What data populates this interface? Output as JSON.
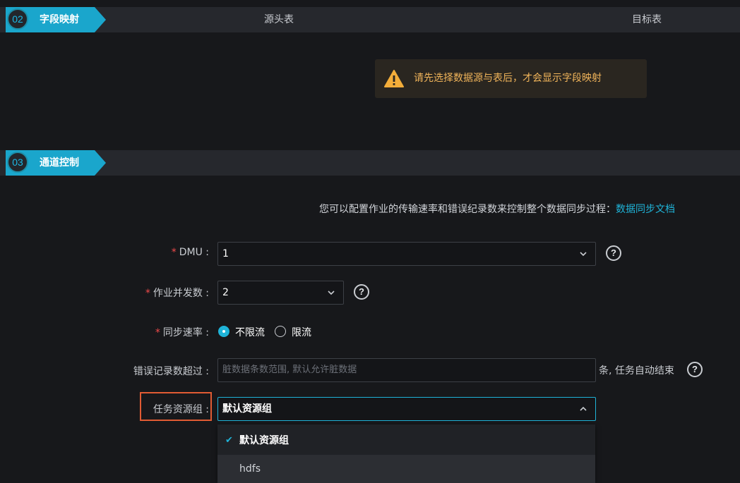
{
  "section_mapping": {
    "number": "02",
    "title": "字段映射",
    "source_table_header": "源头表",
    "target_table_header": "目标表",
    "warning_text": "请先选择数据源与表后，才会显示字段映射"
  },
  "section_channel": {
    "number": "03",
    "title": "通道控制",
    "intro_text": "您可以配置作业的传输速率和错误纪录数来控制整个数据同步过程：",
    "doc_link_text": "数据同步文档"
  },
  "form": {
    "dmu": {
      "label": "DMU :",
      "required_mark": "*",
      "value": "1"
    },
    "concurrency": {
      "label": "作业并发数 :",
      "required_mark": "*",
      "value": "2"
    },
    "sync_rate": {
      "label": "同步速率 :",
      "required_mark": "*",
      "options": [
        "不限流",
        "限流"
      ],
      "selected": "不限流"
    },
    "error_limit": {
      "label": "错误记录数超过 :",
      "placeholder": "脏数据条数范围, 默认允许脏数据",
      "suffix": "条, 任务自动结束"
    },
    "resource_group": {
      "label": "任务资源组 :",
      "value": "默认资源组",
      "options": [
        "默认资源组",
        "hdfs"
      ],
      "selected": "默认资源组"
    },
    "help_glyph": "?"
  },
  "icons": [
    "warning-icon",
    "chevron-down-icon",
    "chevron-up-icon",
    "help-icon",
    "check-icon"
  ],
  "colors": {
    "accent": "#1fb3d8",
    "warning": "#f0b45a",
    "required": "#f04b4b",
    "highlight": "#e15b33"
  }
}
